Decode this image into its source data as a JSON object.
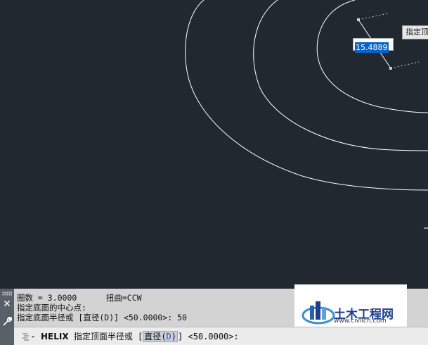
{
  "drawing": {
    "dim_value": "15.4889",
    "tooltip_text": "指定顶"
  },
  "command_history": [
    "圈数 = 3.0000      扭曲=CCW",
    "指定底面的中心点:",
    "指定底面半径或 [直径(D)] <50.0000>: 50"
  ],
  "command_line": {
    "command": "HELIX",
    "prompt_before": " 指定顶面半径或 [",
    "option_label": "直径",
    "option_key_open": "(",
    "option_key": "D",
    "option_key_close": ")",
    "prompt_after": "] <50.0000>:"
  },
  "watermark": {
    "logo_text": "土木工程网",
    "url": "www.civilcn.com"
  },
  "colors": {
    "canvas_bg": "#212830",
    "curve": "#ffffff",
    "selection": "#0a64c8",
    "panel_bg": "#d3d3d3"
  }
}
